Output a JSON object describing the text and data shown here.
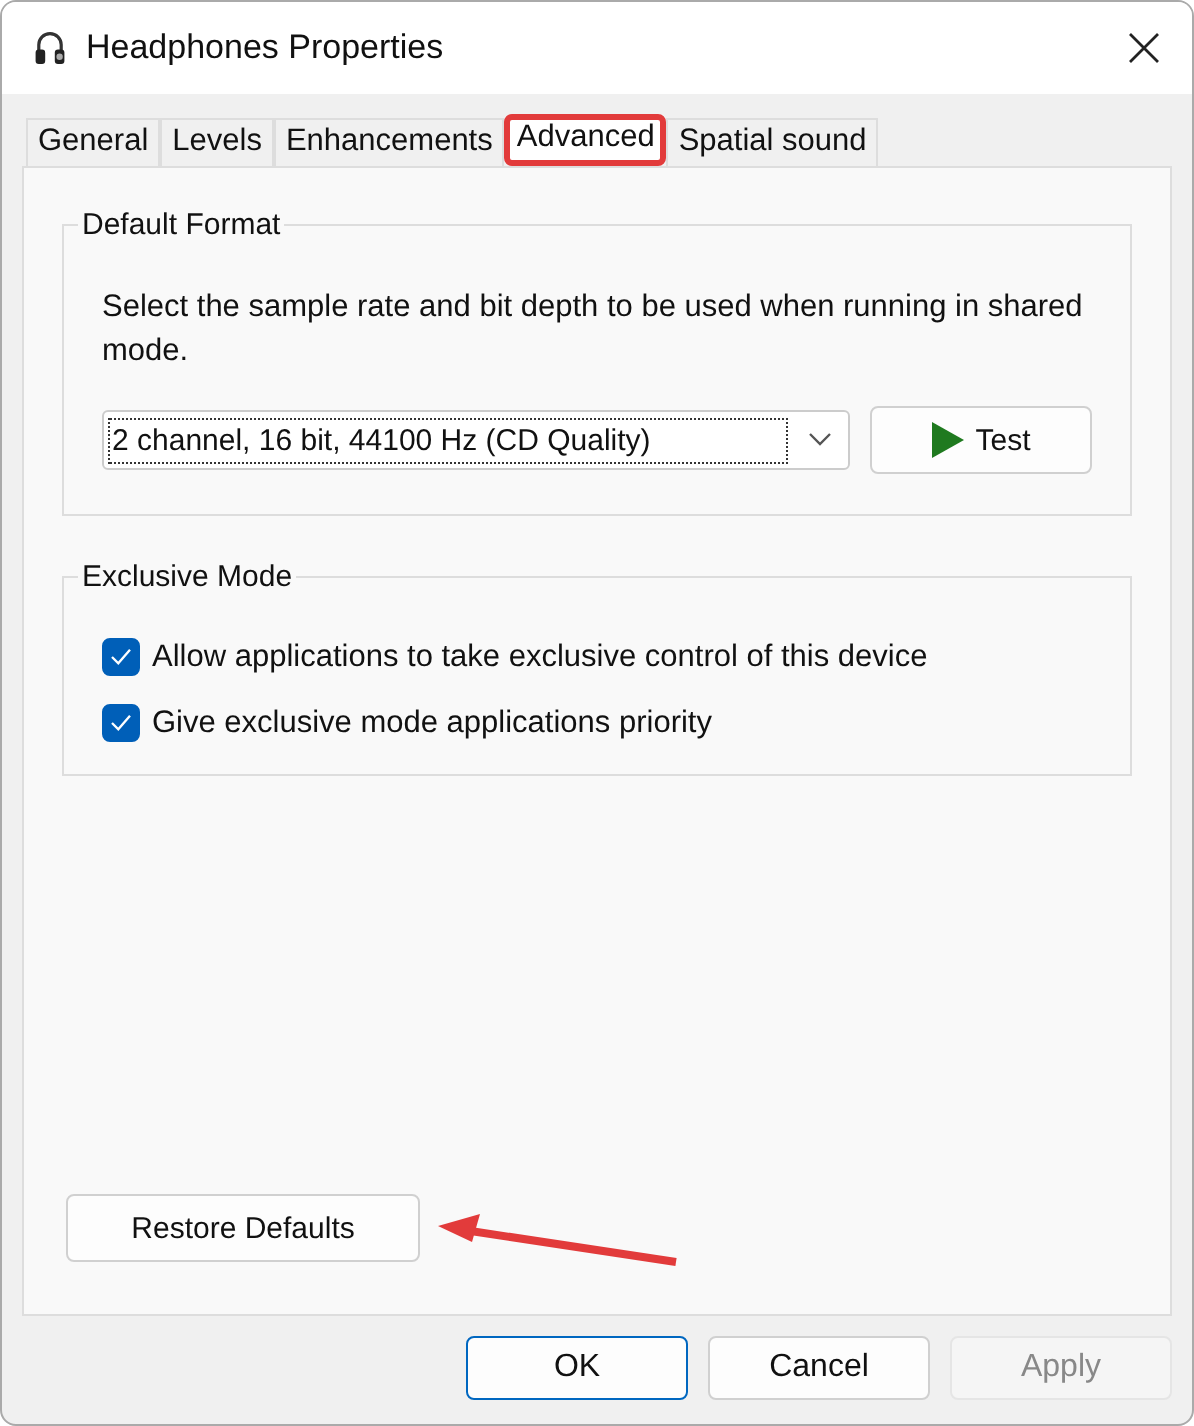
{
  "window": {
    "title": "Headphones Properties"
  },
  "tabs": [
    {
      "label": "General",
      "selected": false,
      "highlighted": false
    },
    {
      "label": "Levels",
      "selected": false,
      "highlighted": false
    },
    {
      "label": "Enhancements",
      "selected": false,
      "highlighted": false
    },
    {
      "label": "Advanced",
      "selected": true,
      "highlighted": true
    },
    {
      "label": "Spatial sound",
      "selected": false,
      "highlighted": false
    }
  ],
  "default_format": {
    "title": "Default Format",
    "description": "Select the sample rate and bit depth to be used when running in shared mode.",
    "format": "2 channel, 16 bit, 44100 Hz (CD Quality)",
    "test_button": "Test"
  },
  "exclusive_mode": {
    "title": "Exclusive Mode",
    "options": [
      {
        "label": "Allow applications to take exclusive control of this device",
        "checked": true
      },
      {
        "label": "Give exclusive mode applications priority",
        "checked": true
      }
    ]
  },
  "restore_button": {
    "label": "Restore Defaults",
    "pointed_at": true
  },
  "buttons": [
    {
      "label": "OK",
      "default": true,
      "disabled": false
    },
    {
      "label": "Cancel",
      "default": false,
      "disabled": false
    },
    {
      "label": "Apply",
      "default": false,
      "disabled": true
    }
  ]
}
